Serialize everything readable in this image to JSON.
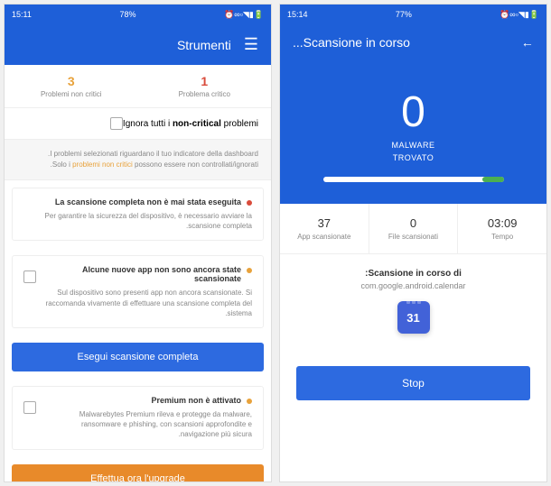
{
  "left": {
    "statusbar": {
      "time": "15:14",
      "battery": "77%",
      "icons": "🔋▮◥▫∞⏰",
      "right_icons": "⬛ M"
    },
    "header": {
      "title": "Scansione in corso..."
    },
    "blue": {
      "count": "0",
      "label1": "MALWARE",
      "label2": "TROVATO"
    },
    "stats": {
      "time": {
        "value": "03:09",
        "label": "Tempo"
      },
      "scanned": {
        "value": "0",
        "label": "File scansionati"
      },
      "apps": {
        "value": "37",
        "label": "App scansionate"
      }
    },
    "scan_info": {
      "title": "Scansione in corso di:",
      "sub": "com.google.android.calendar",
      "cal": "31"
    },
    "stop": "Stop"
  },
  "right": {
    "statusbar": {
      "time": "15:11",
      "battery": "78%",
      "icons": "🔋▮◥▫∞⏰"
    },
    "header": {
      "title": "Strumenti"
    },
    "counts": {
      "critical": {
        "num": "1",
        "label": "Problema critico"
      },
      "noncritical": {
        "num": "3",
        "label": "Problemi non critici"
      }
    },
    "ignore": {
      "text_prefix": "Ignora tutti i ",
      "text_bold": "non-critical ",
      "text_suffix": "problemi"
    },
    "note": {
      "line1": "I problemi selezionati riguardano il tuo indicatore della dashboard.",
      "line2_prefix": "Solo i ",
      "line2_orange": "problemi non critici",
      "line2_suffix": " possono essere non controllati/ignorati."
    },
    "card1": {
      "title": "La scansione completa non è mai stata eseguita",
      "body": "Per garantire la sicurezza del dispositivo, è necessario avviare la scansione completa."
    },
    "card2": {
      "title": "Alcune nuove app non sono ancora state scansionate",
      "body": "Sul dispositivo sono presenti app non ancora scansionate. Si raccomanda vivamente di effettuare una scansione completa del sistema."
    },
    "btn_scan": "Esegui scansione completa",
    "card3": {
      "title": "Premium non è attivato",
      "body": "Malwarebytes Premium rileva e protegge da malware, ransomware e phishing, con scansioni approfondite e navigazione più sicura."
    },
    "btn_upgrade": "Effettua ora l'upgrade"
  }
}
